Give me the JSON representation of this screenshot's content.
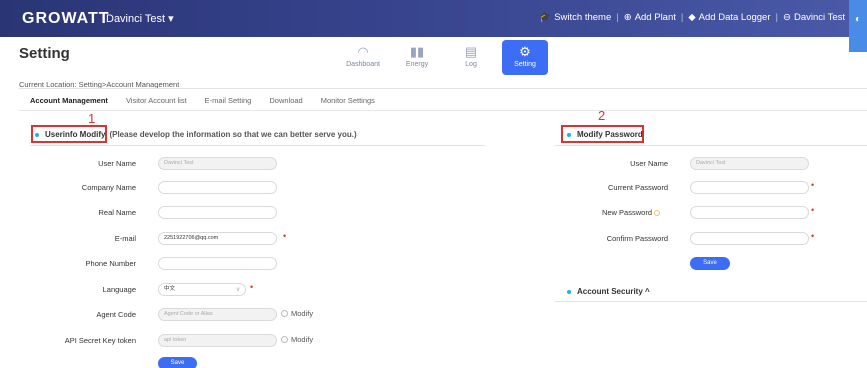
{
  "topbar": {
    "logo": "GROWATT",
    "user_switch": "Davinci Test ▾",
    "links": [
      {
        "icon": "🎓",
        "label": "Switch theme"
      },
      {
        "icon": "⊕",
        "label": "Add Plant"
      },
      {
        "icon": "◆",
        "label": "Add Data Logger"
      },
      {
        "icon": "⊖",
        "label": "Davinci Test"
      }
    ]
  },
  "header": {
    "title": "Setting",
    "tabs": [
      {
        "icon": "◠",
        "label": "Dashboant"
      },
      {
        "icon": "▮▮",
        "label": "Energy"
      },
      {
        "icon": "▤",
        "label": "Log"
      },
      {
        "icon": "⚙",
        "label": "Setting"
      }
    ]
  },
  "breadcrumb": "Current Location: Setting>Account Management",
  "subtabs": [
    "Account Management",
    "Visitor Account list",
    "E-mail Setting",
    "Download",
    "Monitor Settings"
  ],
  "annotations": {
    "one": "1",
    "two": "2"
  },
  "userinfo": {
    "title": "Userinfo Modify",
    "note": "(Please develop the information so that we can better serve you.)",
    "fields": {
      "user_name": {
        "label": "User Name",
        "value": "Davinci Test"
      },
      "company_name": {
        "label": "Company Name",
        "value": ""
      },
      "real_name": {
        "label": "Real Name",
        "value": ""
      },
      "email": {
        "label": "E-mail",
        "value": "2251922706@qq.com"
      },
      "phone": {
        "label": "Phone Number",
        "value": ""
      },
      "language": {
        "label": "Language",
        "value": "中文"
      },
      "agent_code": {
        "label": "Agent Code",
        "placeholder": "Agent Code or Alias"
      },
      "api_token": {
        "label": "API Secret Key token",
        "placeholder": "api token"
      }
    },
    "modify_label": "Modify",
    "save_label": "Save"
  },
  "password": {
    "title": "Modify Password",
    "fields": {
      "user_name": {
        "label": "User Name",
        "value": "Davinci Test"
      },
      "current": {
        "label": "Current Password"
      },
      "new": {
        "label": "New Password"
      },
      "confirm": {
        "label": "Confirm Password"
      }
    },
    "save_label": "Save"
  },
  "security": {
    "title": "Account Security ^"
  },
  "colors": {
    "accent": "#3d6cf5",
    "required": "#e03030",
    "topbar": "#2f3b80"
  }
}
